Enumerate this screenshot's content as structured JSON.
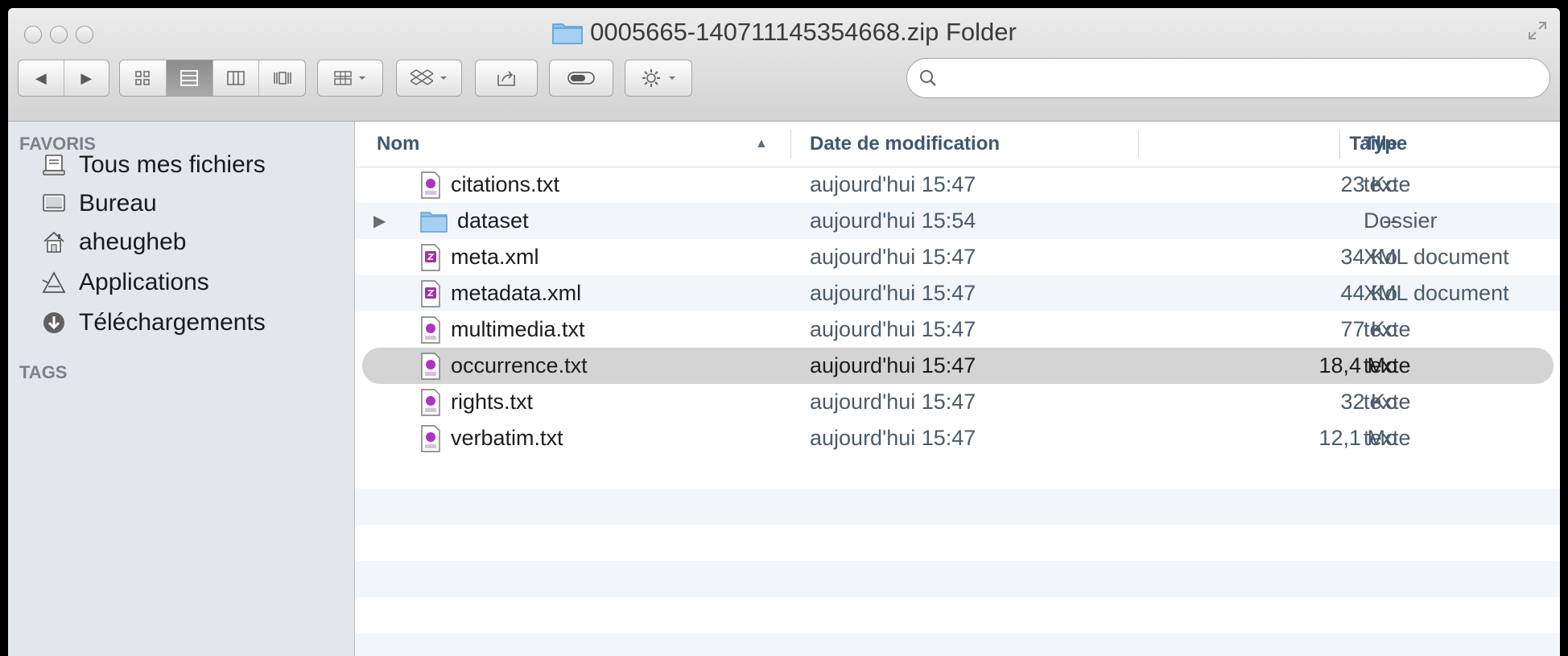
{
  "window": {
    "title": "0005665-140711145354668.zip Folder"
  },
  "toolbar": {
    "back_label": "◀",
    "forward_label": "▶",
    "search_placeholder": ""
  },
  "sidebar": {
    "favorites_heading": "FAVORIS",
    "items": [
      {
        "label": "Tous mes fichiers",
        "icon": "all-files-icon"
      },
      {
        "label": "Bureau",
        "icon": "desktop-icon"
      },
      {
        "label": "aheugheb",
        "icon": "home-icon"
      },
      {
        "label": "Applications",
        "icon": "applications-icon"
      },
      {
        "label": "Téléchargements",
        "icon": "downloads-icon"
      }
    ],
    "tags_heading": "TAGS"
  },
  "columns": {
    "name": "Nom",
    "date": "Date de modification",
    "size": "Taille",
    "type": "Type",
    "sort_indicator": "▲"
  },
  "files": [
    {
      "name": "citations.txt",
      "date": "aujourd'hui 15:47",
      "size": "23 Ko",
      "type": "texte",
      "kind": "txt"
    },
    {
      "name": "dataset",
      "date": "aujourd'hui 15:54",
      "size": "--",
      "type": "Dossier",
      "kind": "folder"
    },
    {
      "name": "meta.xml",
      "date": "aujourd'hui 15:47",
      "size": "34 Ko",
      "type": "XML document",
      "kind": "xml"
    },
    {
      "name": "metadata.xml",
      "date": "aujourd'hui 15:47",
      "size": "44 Ko",
      "type": "XML document",
      "kind": "xml"
    },
    {
      "name": "multimedia.txt",
      "date": "aujourd'hui 15:47",
      "size": "77 Ko",
      "type": "texte",
      "kind": "txt"
    },
    {
      "name": "occurrence.txt",
      "date": "aujourd'hui 15:47",
      "size": "18,4 Mo",
      "type": "texte",
      "kind": "txt",
      "selected": true
    },
    {
      "name": "rights.txt",
      "date": "aujourd'hui 15:47",
      "size": "32 Ko",
      "type": "texte",
      "kind": "txt"
    },
    {
      "name": "verbatim.txt",
      "date": "aujourd'hui 15:47",
      "size": "12,1 Mo",
      "type": "texte",
      "kind": "txt"
    }
  ],
  "colors": {
    "selection": "#d4d4d4",
    "stripe": "#f2f6fb",
    "sidebar_bg": "#e3e7ec",
    "header_text": "#3d5872",
    "folder": "#7fb8e6"
  }
}
